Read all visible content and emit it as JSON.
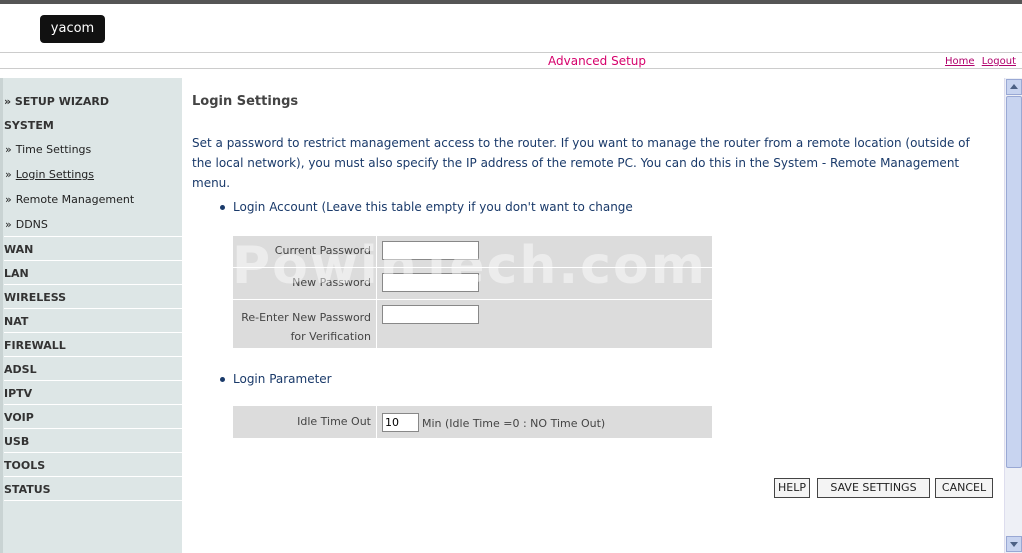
{
  "header": {
    "logo_text": "yacom",
    "section_title": "Advanced Setup",
    "home_link": "Home",
    "logout_link": "Logout"
  },
  "sidebar": {
    "setup_wizard": "» SETUP WIZARD",
    "system": "SYSTEM",
    "sub_items": [
      {
        "label": "Time Settings"
      },
      {
        "label": "Login Settings"
      },
      {
        "label": "Remote Management"
      },
      {
        "label": "DDNS"
      }
    ],
    "items": [
      "WAN",
      "LAN",
      "WIRELESS",
      "NAT",
      "FIREWALL",
      "ADSL",
      "IPTV",
      "VOIP",
      "USB",
      "TOOLS",
      "STATUS"
    ]
  },
  "main": {
    "title": "Login Settings",
    "description": "Set a password to restrict management access to the router. If you want to manage the router from a remote location (outside of the local network), you must also specify the IP address of the remote PC. You can do this in the System - Remote Management menu.",
    "login_account_bullet": "Login Account (Leave this table empty if you don't want to change",
    "current_password_label": "Current Password",
    "new_password_label": "New Password",
    "reenter_password_label": "Re-Enter New Password for Verification",
    "current_password_value": "",
    "new_password_value": "",
    "reenter_password_value": "",
    "login_parameter_bullet": "Login Parameter",
    "idle_label": "Idle Time Out",
    "idle_value": "10",
    "idle_note": "Min (Idle Time =0 : NO Time Out)"
  },
  "buttons": {
    "help": "HELP",
    "save": "SAVE SETTINGS",
    "cancel": "CANCEL"
  },
  "watermark": "PowinTech.com"
}
